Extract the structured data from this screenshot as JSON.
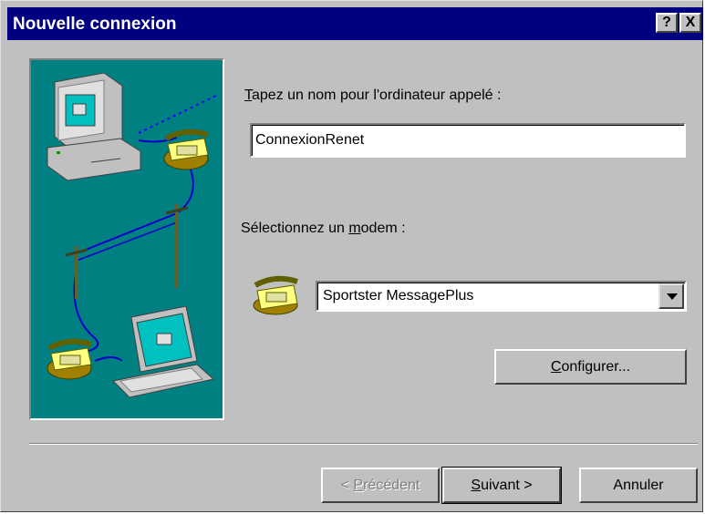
{
  "window": {
    "title": "Nouvelle connexion",
    "help_glyph": "?",
    "close_glyph": "X"
  },
  "form": {
    "name_label_hotkey": "T",
    "name_label_rest": "apez un nom pour l'ordinateur appelé :",
    "name_value": "ConnexionRenet",
    "modem_label_prefix": "Sélectionnez un ",
    "modem_label_hotkey": "m",
    "modem_label_suffix": "odem :",
    "modem_selected": "Sportster MessagePlus",
    "configure_hotkey": "C",
    "configure_rest": "onfigurer..."
  },
  "buttons": {
    "back_prefix": "< ",
    "back_hotkey": "P",
    "back_rest": "récédent",
    "next_hotkey": "S",
    "next_rest": "uivant >",
    "cancel_label": "Annuler"
  },
  "icons": {
    "illustration": "computer-phone-laptop-network-illustration",
    "modem": "modem-telephone-icon",
    "dropdown": "chevron-down-icon"
  },
  "colors": {
    "titlebar": "#000080",
    "face": "#c0c0c0",
    "illustration_bg": "#008080"
  }
}
